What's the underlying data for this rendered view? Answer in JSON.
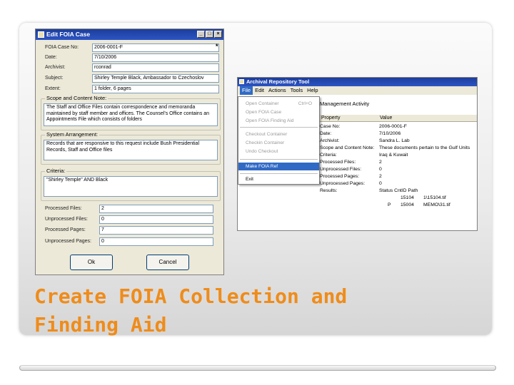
{
  "slide": {
    "title_line1": "Create FOIA Collection and",
    "title_line2": "Finding Aid",
    "title_color": "#ef8c1a"
  },
  "edit_dialog": {
    "title": "Edit FOIA Case",
    "window_buttons": [
      "_",
      "□",
      "×"
    ],
    "fields": [
      {
        "label": "FOIA Case No:",
        "value": "2006-0001-F"
      },
      {
        "label": "Date:",
        "value": "7/10/2006"
      },
      {
        "label": "Archivist:",
        "value": "rconrad"
      },
      {
        "label": "Subject:",
        "value": "Shirley Temple Black, Ambassador to Czechoslov"
      },
      {
        "label": "Extent:",
        "value": "1 folder, 6 pages"
      }
    ],
    "required_marker": "*",
    "groups": [
      {
        "label": "Scope and Content Note:",
        "text": "The Staff and Office Files contain correspondence and memoranda maintained by staff member and offices. The Counsel's Office contains an Appointments File which consists of folders"
      },
      {
        "label": "System Arrangement:",
        "text": "Records that are responsive to this request include Bush Presidential Records, Staff and Office files"
      },
      {
        "label": "Criteria:",
        "text": "\"Shirley Temple\" AND Black"
      }
    ],
    "counts": [
      {
        "label": "Processed Files:",
        "value": "2"
      },
      {
        "label": "Unprocessed Files:",
        "value": "0"
      },
      {
        "label": "Processed Pages:",
        "value": "7"
      },
      {
        "label": "Unprocessed Pages:",
        "value": "0"
      }
    ],
    "ok_label": "Ok",
    "cancel_label": "Cancel"
  },
  "archival_window": {
    "title": "Archival Repository Tool",
    "menu": [
      "File",
      "Edit",
      "Actions",
      "Tools",
      "Help"
    ],
    "active_menu": "File",
    "tab_header": "Management Activity",
    "grid_headers": [
      "Property",
      "Value"
    ],
    "rows": [
      {
        "property": "Case No:",
        "value": "2006-0001-F"
      },
      {
        "property": "Date:",
        "value": "7/10/2006"
      },
      {
        "property": "Archivist:",
        "value": "Sandra L. Lab"
      },
      {
        "property": "Scope and Content Note:",
        "value": "These documents pertain to the Gulf Units"
      },
      {
        "property": "Criteria:",
        "value": "Iraq & Kuwait"
      },
      {
        "property": "Processed Files:",
        "value": "2"
      },
      {
        "property": "Unprocessed Files:",
        "value": "0"
      },
      {
        "property": "Processed Pages:",
        "value": "2"
      },
      {
        "property": "Unprocessed Pages:",
        "value": "0"
      },
      {
        "property": "Results:",
        "value": "Status   CntID    Path"
      }
    ],
    "result_rows": [
      {
        "status": "",
        "cnt": "15104",
        "path": "1\\15104.tif"
      },
      {
        "status": "P",
        "cnt": "15004",
        "path": "MEMO\\31.tif"
      }
    ],
    "file_menu": [
      {
        "label": "Open Container",
        "shortcut": "Ctrl+O",
        "enabled": false
      },
      {
        "label": "Open FOIA Case",
        "shortcut": "",
        "enabled": false
      },
      {
        "label": "Open FOIA Finding Aid",
        "shortcut": "",
        "enabled": false
      },
      {
        "label": "Checkout Container",
        "shortcut": "",
        "enabled": false
      },
      {
        "label": "Checkin Container",
        "shortcut": "",
        "enabled": false
      },
      {
        "label": "Undo Checkout",
        "shortcut": "",
        "enabled": false
      },
      {
        "label": "Make FOIA Ref",
        "shortcut": "",
        "enabled": true,
        "highlighted": true
      },
      {
        "label": "Exit",
        "shortcut": "",
        "enabled": true
      }
    ]
  }
}
